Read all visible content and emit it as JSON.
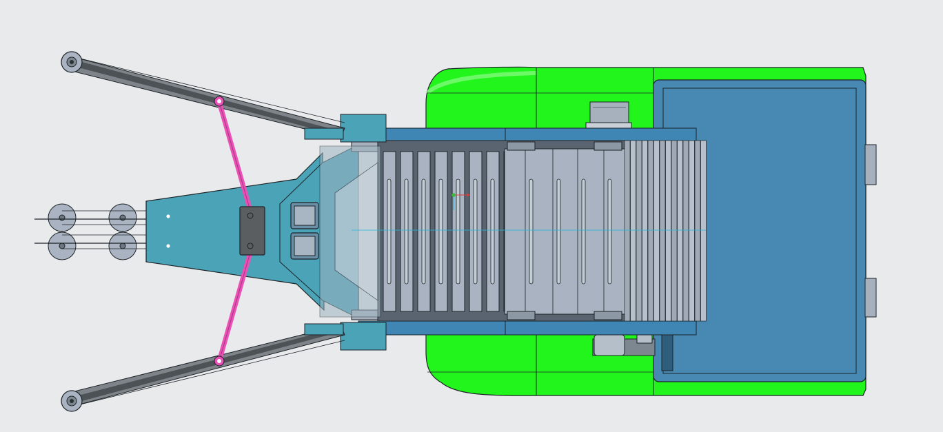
{
  "scene": {
    "description_hidden": "",
    "colors": {
      "background": "#e9eaec",
      "body_green": "#22f51c",
      "hopper_blue": "#4889b3",
      "frame_teal": "#4aa3b6",
      "frame_blue": "#3f86b5",
      "arm_dark": "#5a5e60",
      "actuator_pink": "#ec4fb6",
      "roller_grey": "#a9b3c1",
      "edge": "#1c2226"
    },
    "icons": [
      "triad-axes-icon"
    ],
    "roller_slat_count": 14,
    "rear_roller_count": 5,
    "front_pulley_count": 4,
    "cut_text_none": ""
  }
}
